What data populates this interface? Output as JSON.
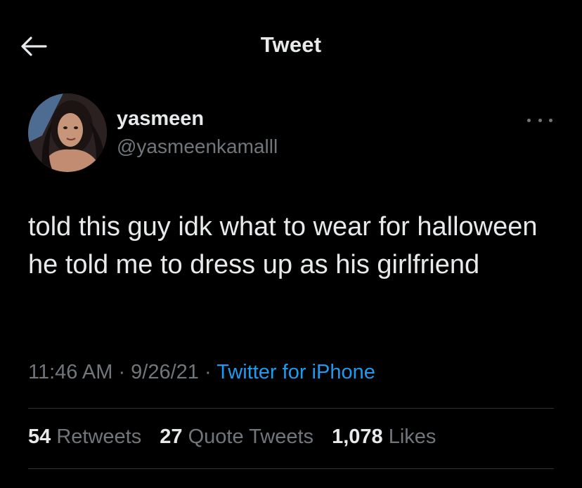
{
  "header": {
    "title": "Tweet",
    "back_icon": "arrow-left-icon"
  },
  "author": {
    "name": "yasmeen",
    "handle": "@yasmeenkamalll",
    "avatar": "profile-photo"
  },
  "tweet": {
    "text": "told this guy idk what to wear for halloween he told me to dress up as his girlfriend",
    "time": "11:46 AM",
    "sep1": " · ",
    "date": "9/26/21",
    "sep2": " · ",
    "source": "Twitter for iPhone"
  },
  "stats": {
    "retweets_count": "54",
    "retweets_label": "Retweets",
    "quotes_count": "27",
    "quotes_label": "Quote Tweets",
    "likes_count": "1,078",
    "likes_label": "Likes"
  },
  "colors": {
    "background": "#000000",
    "text_primary": "#e7e9ea",
    "text_secondary": "#71767b",
    "link": "#1d9bf0",
    "divider": "#2f3336"
  }
}
